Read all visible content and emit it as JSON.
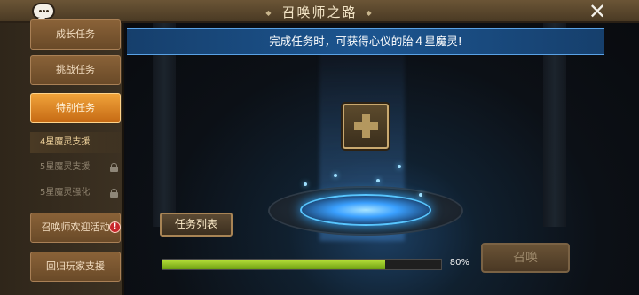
{
  "header": {
    "title": "召唤师之路"
  },
  "sidebar": {
    "tabs": [
      {
        "label": "成长任务",
        "state": "normal"
      },
      {
        "label": "挑战任务",
        "state": "normal"
      },
      {
        "label": "特别任务",
        "state": "active"
      }
    ],
    "sub_items": [
      {
        "label": "4星魔灵支援",
        "state": "selected"
      },
      {
        "label": "5星魔灵支援",
        "state": "locked"
      },
      {
        "label": "5星魔灵强化",
        "state": "locked"
      }
    ],
    "events": [
      {
        "label": "召唤师欢迎活动",
        "badge": "!"
      },
      {
        "label": "回归玩家支援"
      }
    ]
  },
  "main": {
    "banner": "完成任务时，可获得心仪的胎４星魔灵!",
    "task_list_button": "任务列表",
    "summon_button": "召唤",
    "summon_enabled": false,
    "progress": {
      "value": 0.8,
      "label": "80%"
    }
  },
  "colors": {
    "accent": "#f0a33a",
    "progress": "#8bc320",
    "banner": "#1c5590"
  }
}
